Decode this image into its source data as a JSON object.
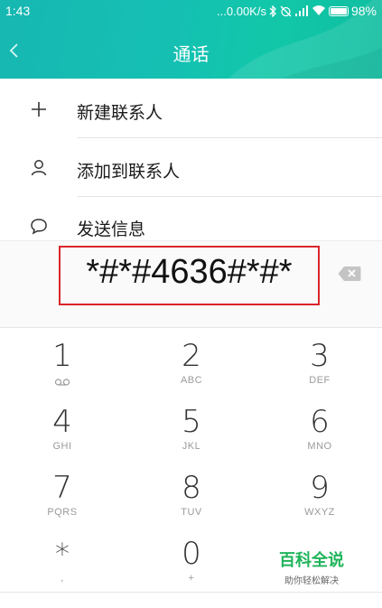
{
  "status_bar": {
    "time": "1:43",
    "network_speed": "...0.00K/s",
    "battery_percent": "98%",
    "icons": [
      "bluetooth-icon",
      "alarm-off-icon",
      "signal-icon",
      "wifi-icon",
      "battery-icon"
    ]
  },
  "header": {
    "back_icon": "chevron-left-icon",
    "title": "通话"
  },
  "menu": [
    {
      "icon": "plus-icon",
      "label": "新建联系人"
    },
    {
      "icon": "person-icon",
      "label": "添加到联系人"
    },
    {
      "icon": "chat-bubble-icon",
      "label": "发送信息"
    }
  ],
  "dialer": {
    "number": "*#*#4636#*#*",
    "backspace_icon": "backspace-icon",
    "keys": [
      {
        "digit": "1",
        "letters": ""
      },
      {
        "digit": "2",
        "letters": "ABC"
      },
      {
        "digit": "3",
        "letters": "DEF"
      },
      {
        "digit": "4",
        "letters": "GHI"
      },
      {
        "digit": "5",
        "letters": "JKL"
      },
      {
        "digit": "6",
        "letters": "MNO"
      },
      {
        "digit": "7",
        "letters": "PQRS"
      },
      {
        "digit": "8",
        "letters": "TUV"
      },
      {
        "digit": "9",
        "letters": "WXYZ"
      },
      {
        "digit": "*",
        "letters": ","
      },
      {
        "digit": "0",
        "letters": "+"
      }
    ]
  },
  "watermark": {
    "title": "百科全说",
    "subtitle": "助你轻松解决"
  },
  "colors": {
    "header_teal": "#15c0b3",
    "highlight_red": "#d9262c",
    "watermark_green": "#1fb45a"
  }
}
